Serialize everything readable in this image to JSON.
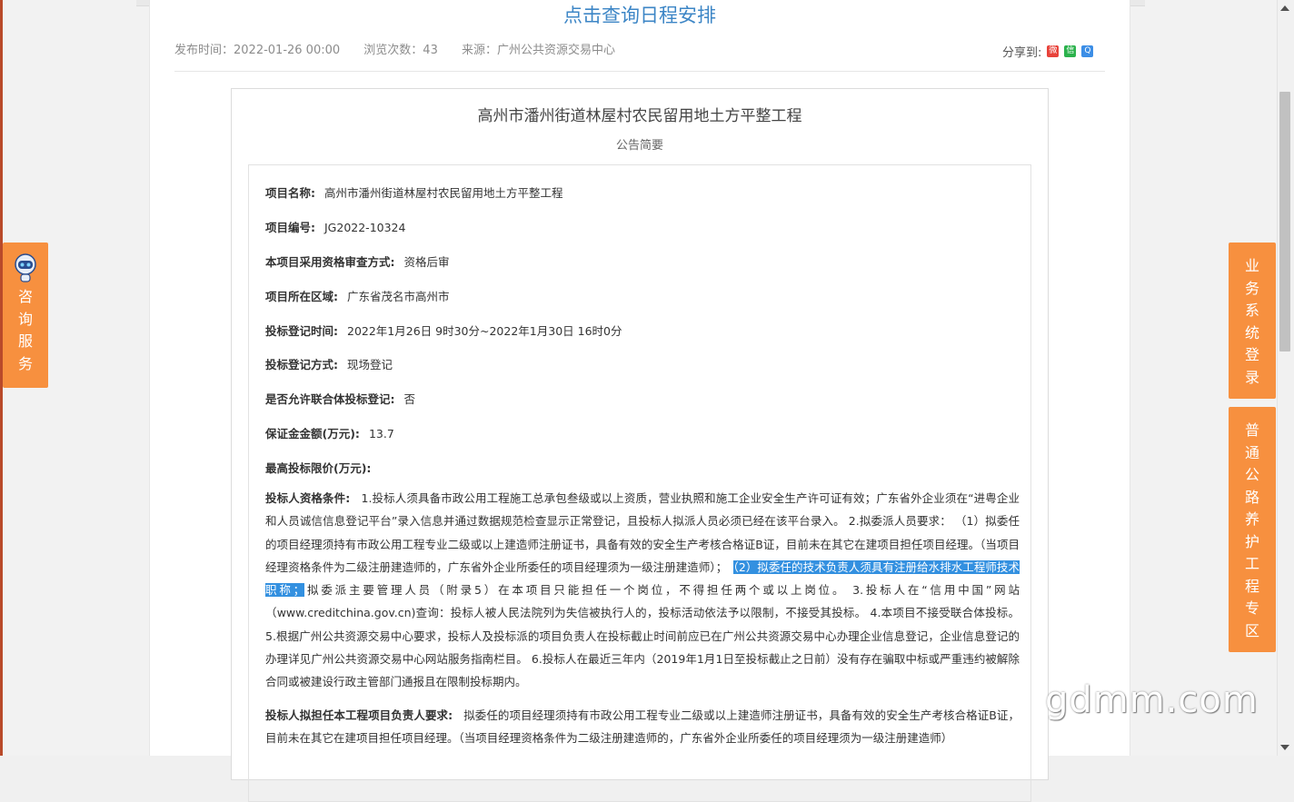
{
  "header": {
    "schedule_link": "点击查询日程安排"
  },
  "meta": {
    "publish_time": "发布时间：2022-01-26 00:00",
    "views": "浏览次数：43",
    "source": "来源：广州公共资源交易中心",
    "share_label": "分享到:"
  },
  "notice": {
    "title": "高州市潘州街道林屋村农民留用地土方平整工程",
    "subtitle": "公告简要"
  },
  "fields": [
    {
      "label": "项目名称:",
      "value": "高州市潘州街道林屋村农民留用地土方平整工程"
    },
    {
      "label": "项目编号:",
      "value": "JG2022-10324"
    },
    {
      "label": "本项目采用资格审查方式:",
      "value": "资格后审"
    },
    {
      "label": "项目所在区域:",
      "value": "广东省茂名市高州市"
    },
    {
      "label": "投标登记时间:",
      "value": "2022年1月26日 9时30分~2022年1月30日 16时0分"
    },
    {
      "label": "投标登记方式:",
      "value": "现场登记"
    },
    {
      "label": "是否允许联合体投标登记:",
      "value": "否"
    },
    {
      "label": "保证金金额(万元):",
      "value": "13.7"
    },
    {
      "label": "最高投标限价(万元):",
      "value": ""
    }
  ],
  "qualification": {
    "label": "投标人资格条件:",
    "text_before": "1.投标人须具备市政公用工程施工总承包叁级或以上资质，营业执照和施工企业安全生产许可证有效；广东省外企业须在“进粤企业和人员诚信信息登记平台”录入信息并通过数据规范检查显示正常登记，且投标人拟派人员必须已经在该平台录入。 2.拟委派人员要求： （1）拟委任的项目经理须持有市政公用工程专业二级或以上建造师注册证书，具备有效的安全生产考核合格证B证，目前未在其它在建项目担任项目经理。（当项目经理资格条件为二级注册建造师的，广东省外企业所委任的项目经理须为一级注册建造师）；　",
    "text_highlight": "（2）拟委任的技术负责人须具有注册给水排水工程师技术职称；",
    "text_after": "拟委派主要管理人员（附录5）在本项目只能担任一个岗位，不得担任两个或以上岗位。 3.投标人在“信用中国”网站（www.creditchina.gov.cn)查询：投标人被人民法院列为失信被执行人的，投标活动依法予以限制，不接受其投标。 4.本项目不接受联合体投标。5.根据广州公共资源交易中心要求，投标人及投标派的项目负责人在投标截止时间前应已在广州公共资源交易中心办理企业信息登记，企业信息登记的办理详见广州公共资源交易中心网站服务指南栏目。 6.投标人在最近三年内（2019年1月1日至投标截止之日前）没有存在骗取中标或严重违约被解除合同或被建设行政主管部门通报且在限制投标期内。"
  },
  "manager_req": {
    "label": "投标人拟担任本工程项目负责人要求:",
    "text": "拟委任的项目经理须持有市政公用工程专业二级或以上建造师注册证书，具备有效的安全生产考核合格证B证，目前未在其它在建项目担任项目经理。（当项目经理资格条件为二级注册建造师的，广东省外企业所委任的项目经理须为一级注册建造师）"
  },
  "floats": {
    "consult": "咨询服务",
    "business_login": "业务系统登录",
    "road_zone": "普通公路养护工程专区"
  },
  "watermark": "gdmm.com",
  "colors": {
    "accent": "#f7903f",
    "link": "#3d86c6",
    "highlight": "#3390e0"
  },
  "icons": [
    "weibo-icon",
    "wechat-icon",
    "qq-icon",
    "robot-icon"
  ]
}
